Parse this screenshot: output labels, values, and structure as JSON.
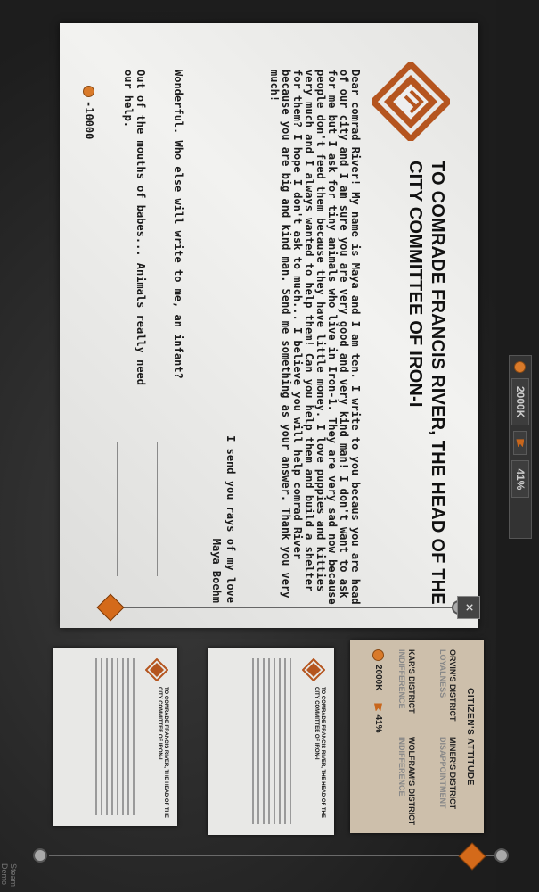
{
  "letter": {
    "title": "TO COMRADE FRANCIS RIVER, THE HEAD OF THE CITY COMMITTEE OF IRON-I",
    "body": "Dear comrad River! My name is Maya and I am ten. I write to you becaus you are head of our city and I am sure you are very good and very kind man! I don't want to ask for me but I ask for tiny animals who live in Iron-1. They are very sad now because people don't feed them because they have little money. I love puppies and kitties very much and I always wanted to help them! Can you help them and build a shelter for them? I hope I don't ask to much... I believe you will help comrad River because you are big and kind man. Send me something as your answer. Thank you very much!",
    "signature_line1": "I send you rays of my love",
    "signature_line2": "Maya Boehm",
    "options": [
      {
        "text": "Wonderful. Who else will write to me, an infant?"
      },
      {
        "text": "Out of the mouths of babes... Animals really need our help."
      }
    ],
    "cost": "-10000",
    "close_icon": "close-icon"
  },
  "thumbnails": [
    {
      "title": "TO COMRADE FRANCIS RIVER, THE HEAD OF THE CITY COMMITTEE OF IRON-I"
    },
    {
      "title": "TO COMRADE FRANCIS RIVER, THE HEAD OF THE CITY COMMITTEE OF IRON-I"
    }
  ],
  "attitude_card": {
    "title": "CITIZEN'S ATTITUDE",
    "districts": [
      {
        "name": "ORVIN'S DISTRICT",
        "attitude": "LOYALNESS"
      },
      {
        "name": "MINER'S DISTRICT",
        "attitude": "DISAPPOINTMENT"
      },
      {
        "name": "KAR'S DISTRICT",
        "attitude": "INDIFFERENCE"
      },
      {
        "name": "WOLFRAM'S DISTRICT",
        "attitude": "INDIFFERENCE"
      }
    ],
    "money": "2000K",
    "approval": "41%"
  },
  "status_bar": {
    "money": "2000K",
    "approval": "41%"
  },
  "footer": {
    "watermark": "Steam Demo 2..."
  },
  "colors": {
    "accent": "#d46a1a",
    "seal": "#b5551f",
    "paper": "#ececea"
  }
}
